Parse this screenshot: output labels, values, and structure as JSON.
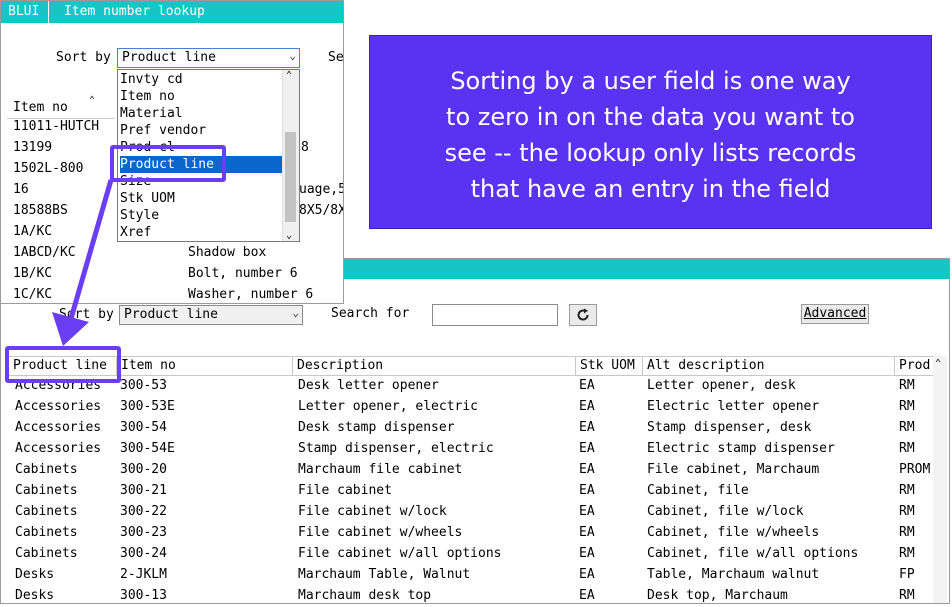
{
  "front": {
    "title_left": "BLUI",
    "title_right": "Item number lookup",
    "sort_label": "Sort by",
    "sort_value": "Product line",
    "search_label_partial": "Se",
    "list_header": "Item no",
    "items": [
      "11011-HUTCH",
      "13199",
      "1502L-800",
      "16",
      "18588BS",
      "1A/KC",
      "1ABCD/KC",
      "1B/KC",
      "1C/KC"
    ],
    "desc_visible": [
      {
        "row": 1,
        "text": "8"
      },
      {
        "row": 3,
        "text": "uage,5"
      },
      {
        "row": 4,
        "text": "8X5/8X"
      },
      {
        "row": 6,
        "text": "Shadow box"
      },
      {
        "row": 7,
        "text": "Bolt, number 6"
      },
      {
        "row": 8,
        "text": "Washer, number 6"
      }
    ],
    "dropdown_options": [
      "Invty cd",
      "Item no",
      "Material",
      "Pref vendor",
      "Prod cl",
      "Product line",
      "Size",
      "Stk UOM",
      "Style",
      "Xref"
    ],
    "dropdown_selected": "Product line"
  },
  "back": {
    "sort_label": "Sort by",
    "sort_value": "Product line",
    "search_label": "Search for",
    "search_value": "",
    "refresh_icon": "refresh-icon",
    "advanced_label": "Advanced",
    "columns": [
      "Product line",
      "Item no",
      "Description",
      "Stk UOM",
      "Alt description",
      "Prod"
    ],
    "rows": [
      [
        "Accessories",
        "300-53",
        "Desk letter opener",
        "EA",
        "Letter opener, desk",
        "RM"
      ],
      [
        "Accessories",
        "300-53E",
        "Letter opener, electric",
        "EA",
        "Electric letter opener",
        "RM"
      ],
      [
        "Accessories",
        "300-54",
        "Desk stamp dispenser",
        "EA",
        "Stamp dispenser, desk",
        "RM"
      ],
      [
        "Accessories",
        "300-54E",
        "Stamp dispenser, electric",
        "EA",
        "Electric stamp dispenser",
        "RM"
      ],
      [
        "Cabinets",
        "300-20",
        "Marchaum file cabinet",
        "EA",
        "File cabinet, Marchaum",
        "PROM"
      ],
      [
        "Cabinets",
        "300-21",
        "File cabinet",
        "EA",
        "Cabinet, file",
        "RM"
      ],
      [
        "Cabinets",
        "300-22",
        "File cabinet w/lock",
        "EA",
        "Cabinet, file w/lock",
        "RM"
      ],
      [
        "Cabinets",
        "300-23",
        "File cabinet w/wheels",
        "EA",
        "Cabinet, file w/wheels",
        "RM"
      ],
      [
        "Cabinets",
        "300-24",
        "File cabinet w/all options",
        "EA",
        "Cabinet, file w/all options",
        "RM"
      ],
      [
        "Desks",
        "2-JKLM",
        "Marchaum Table, Walnut",
        "EA",
        "Table, Marchaum walnut",
        "FP"
      ],
      [
        "Desks",
        "300-13",
        "Marchaum desk top",
        "EA",
        "Desk top, Marchaum",
        "RM"
      ]
    ]
  },
  "callout": {
    "lines": [
      "Sorting by a user field is one way",
      "to zero in on the data you want to",
      "see -- the lookup only lists records",
      "that have an entry in the field"
    ]
  },
  "colors": {
    "title_bar": "#16c6c4",
    "callout_bg": "#5a32f2",
    "highlight": "#6a3ef5",
    "selection": "#0a66cc"
  }
}
